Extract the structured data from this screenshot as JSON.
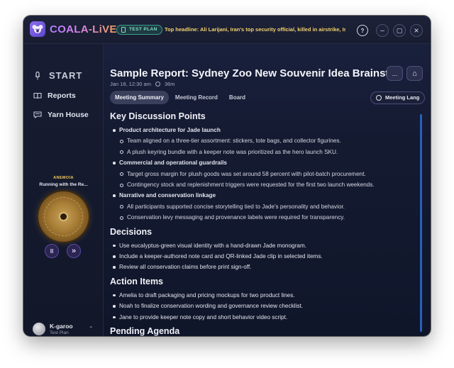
{
  "app": {
    "brand": "COALA-LiVE",
    "plan_badge": "TEST PLAN",
    "headline": "Top headline: Ali Larijani, Iran's top security official, killed in airstrike, Israel sa...",
    "help_glyph": "?",
    "minimize_glyph": "–",
    "maximize_glyph": "▢",
    "close_glyph": "×"
  },
  "sidebar": {
    "start_label": "START",
    "items": [
      {
        "label": "Reports",
        "icon": "book-icon"
      },
      {
        "label": "Yarn House",
        "icon": "chat-icon"
      }
    ],
    "player": {
      "artist": "ANEMOIA",
      "title": "Running with the Re...",
      "pause_glyph": "II",
      "next_glyph": "»"
    },
    "user": {
      "name": "K-garoo",
      "plan": "Test Plan",
      "expand_glyph": "⌃"
    }
  },
  "report": {
    "title": "Sample Report: Sydney Zoo New Souvenir Idea Brainsto...",
    "date": "Jan 18, 12:30 am",
    "duration": "36m",
    "more_glyph": "...",
    "home_glyph": "⌂",
    "tabs": [
      "Meeting Summary",
      "Meeting Record",
      "Board"
    ],
    "active_tab": 0,
    "lang_label": "Meeting Lang"
  },
  "summary": {
    "key_points_title": "Key Discussion Points",
    "key_points": [
      {
        "title": "Product architecture for Jade launch",
        "subs": [
          "Team aligned on a three-tier assortment: stickers, tote bags, and collector figurines.",
          "A plush keyring bundle with a keeper note was prioritized as the hero launch SKU."
        ]
      },
      {
        "title": "Commercial and operational guardrails",
        "subs": [
          "Target gross margin for plush goods was set around 58 percent with pilot-batch procurement.",
          "Contingency stock and replenishment triggers were requested for the first two launch weekends."
        ]
      },
      {
        "title": "Narrative and conservation linkage",
        "subs": [
          "All participants supported concise storytelling tied to Jade's personality and behavior.",
          "Conservation levy messaging and provenance labels were required for transparency."
        ]
      }
    ],
    "decisions_title": "Decisions",
    "decisions": [
      "Use eucalyptus-green visual identity with a hand-drawn Jade monogram.",
      "Include a keeper-authored note card and QR-linked Jade clip in selected items.",
      "Review all conservation claims before print sign-off."
    ],
    "actions_title": "Action Items",
    "actions": [
      "Amelia to draft packaging and pricing mockups for two product lines.",
      "Noah to finalize conservation wording and governance review checklist.",
      "Jane to provide keeper note copy and short behavior video script."
    ],
    "pending_title": "Pending Agenda"
  },
  "colors": {
    "brand_purple": "#b07cff",
    "brand_orange": "#f3a05a",
    "badge_teal": "#7fe0c6",
    "headline_gold": "#f2d16e",
    "scrollbar_blue": "#2a5fbf"
  }
}
